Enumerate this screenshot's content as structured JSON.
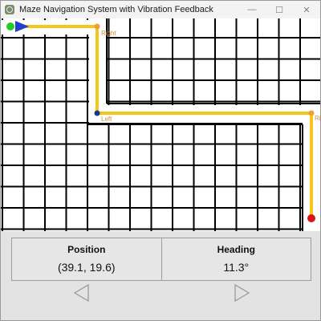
{
  "window": {
    "title": "Maze Navigation System with Vibration Feedback",
    "controls": {
      "minimize": "—",
      "maximize": "☐",
      "close": "✕"
    }
  },
  "maze": {
    "turn_labels": [
      "Right",
      "Left",
      "Ri"
    ],
    "colors": {
      "path": "#f5c518",
      "grid": "#000000",
      "start_marker": "#22cc22",
      "heading_arrow": "#1f3fd0",
      "goal_marker": "#dd1111",
      "right_turn_marker": "#f0a030",
      "left_turn_marker": "#1a3a8a",
      "turn_label": "#c89040"
    }
  },
  "status": {
    "position_label": "Position",
    "position_value": "(39.1, 19.6)",
    "heading_label": "Heading",
    "heading_value": "11.3°"
  },
  "navigation": {
    "left_icon": "left-triangle-icon",
    "right_icon": "right-triangle-icon"
  }
}
